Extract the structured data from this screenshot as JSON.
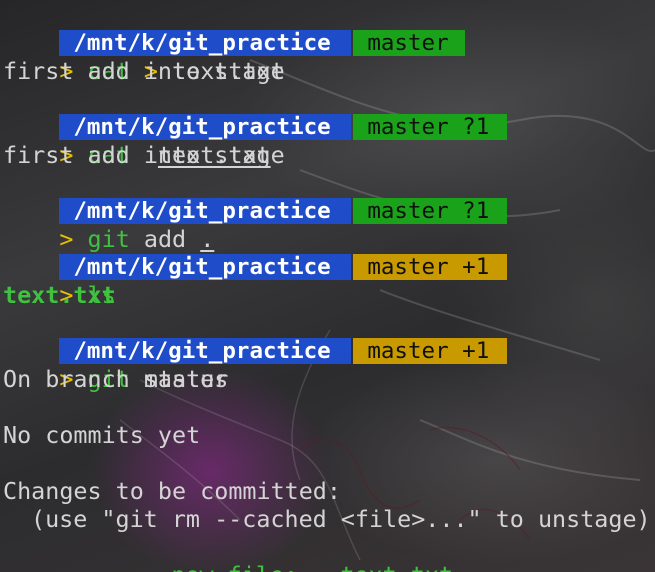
{
  "prompt": {
    "arrow": ">",
    "path": "/mnt/k/git_practice",
    "branch_clean": "master",
    "branch_untracked": "master ?1",
    "branch_staged": "master +1"
  },
  "commands": {
    "c1": {
      "cmd": "cat",
      "redir": ">",
      "arg": "text.txt"
    },
    "c2": {
      "cmd": "cat",
      "arg": "text.txt"
    },
    "c3": {
      "cmd": "git",
      "arg1": "add",
      "arg2": "."
    },
    "c4": {
      "cmd": "ls"
    },
    "c5": {
      "cmd": "git",
      "arg": "status"
    }
  },
  "output": {
    "typed_line": "first add into stage",
    "cat_output": "first add into stage",
    "ls_output": "text.txt",
    "status_branch": "On branch master",
    "status_no_commits": "No commits yet",
    "status_changes_header": "Changes to be committed:",
    "status_hint": "(use \"git rm --cached <file>...\" to unstage)",
    "status_file_label": "new file:",
    "status_file_name": "text.txt"
  },
  "colors": {
    "path_segment": "#1f4dc9",
    "branch_clean": "#1aa31a",
    "branch_staged": "#c89a00",
    "prompt_arrow": "#e8c000",
    "command": "#3fc33f"
  }
}
